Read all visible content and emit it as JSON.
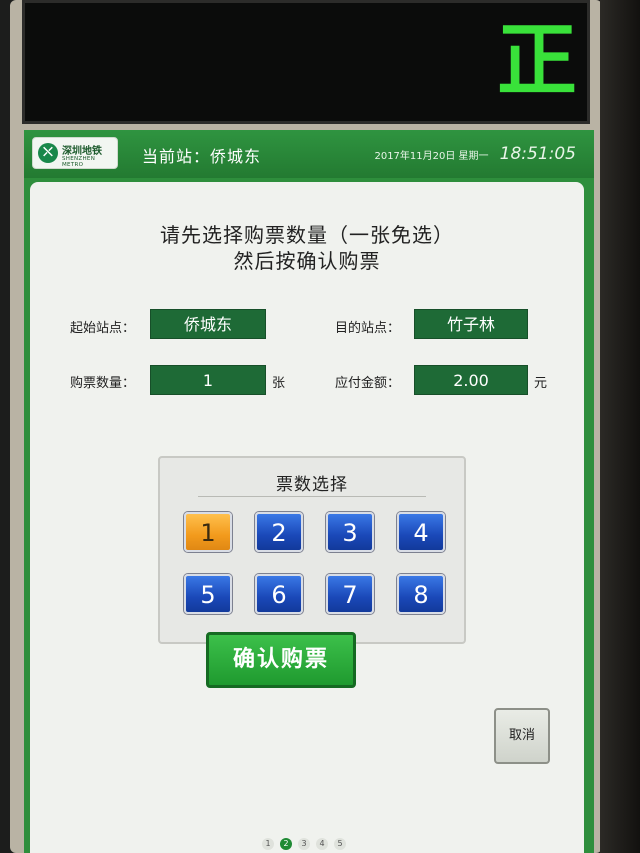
{
  "led": {
    "glyph": "正"
  },
  "header": {
    "logo_cn": "深圳地铁",
    "logo_en": "SHENZHEN METRO",
    "station_label": "当前站：侨城东",
    "date": "2017年11月20日  星期一",
    "time": "18:51:05"
  },
  "instruction": {
    "line1": "请先选择购票数量（一张免选）",
    "line2": "然后按确认购票"
  },
  "form": {
    "origin_label": "起始站点：",
    "origin_value": "侨城东",
    "dest_label": "目的站点：",
    "dest_value": "竹子林",
    "qty_label": "购票数量：",
    "qty_value": "1",
    "qty_unit": "张",
    "amount_label": "应付金额：",
    "amount_value": "2.00",
    "amount_unit": "元"
  },
  "ticket_select": {
    "title": "票数选择",
    "buttons": [
      "1",
      "2",
      "3",
      "4",
      "5",
      "6",
      "7",
      "8"
    ],
    "selected": "1"
  },
  "actions": {
    "confirm": "确认购票",
    "cancel": "取消"
  },
  "pager": {
    "pages": [
      "1",
      "2",
      "3",
      "4",
      "5"
    ],
    "current": "2"
  },
  "colors": {
    "header_green": "#2e8e3c",
    "field_green": "#1e6a36",
    "button_blue": "#1a48b8",
    "selected_orange": "#f29a1c",
    "confirm_green": "#1f9a2f",
    "led_green": "#39e23a"
  }
}
